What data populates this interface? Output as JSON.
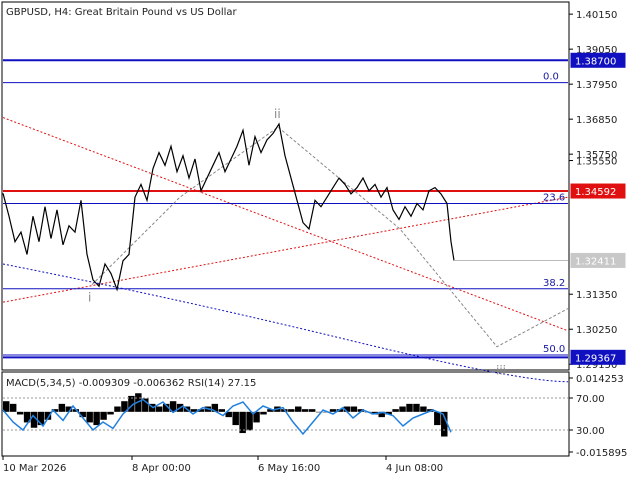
{
  "chart_data": [
    {
      "type": "line",
      "title": "GBPUSD, H4:  Great Britain Pound vs US Dollar",
      "ylim": [
        1.29,
        1.405
      ],
      "y_ticks": [
        "1.40150",
        "1.39050",
        "1.37950",
        "1.36850",
        "1.35750",
        "1.35550",
        "1.31350",
        "1.30250",
        "1.29150"
      ],
      "x_ticks": [
        "10 Mar 2026",
        "8 Apr 00:00",
        "6 May 16:00",
        "4 Jun 08:00"
      ],
      "price_series": [
        [
          0,
          1.3452
        ],
        [
          6,
          1.338
        ],
        [
          12,
          1.33
        ],
        [
          18,
          1.333
        ],
        [
          24,
          1.326
        ],
        [
          30,
          1.338
        ],
        [
          36,
          1.33
        ],
        [
          42,
          1.341
        ],
        [
          48,
          1.331
        ],
        [
          54,
          1.34
        ],
        [
          60,
          1.329
        ],
        [
          66,
          1.335
        ],
        [
          72,
          1.333
        ],
        [
          78,
          1.343
        ],
        [
          84,
          1.326
        ],
        [
          90,
          1.318
        ],
        [
          96,
          1.316
        ],
        [
          102,
          1.323
        ],
        [
          108,
          1.32
        ],
        [
          114,
          1.315
        ],
        [
          120,
          1.324
        ],
        [
          126,
          1.326
        ],
        [
          132,
          1.344
        ],
        [
          138,
          1.348
        ],
        [
          144,
          1.343
        ],
        [
          150,
          1.353
        ],
        [
          156,
          1.358
        ],
        [
          162,
          1.354
        ],
        [
          168,
          1.36
        ],
        [
          174,
          1.352
        ],
        [
          180,
          1.357
        ],
        [
          186,
          1.35
        ],
        [
          192,
          1.356
        ],
        [
          198,
          1.346
        ],
        [
          204,
          1.35
        ],
        [
          210,
          1.354
        ],
        [
          216,
          1.358
        ],
        [
          222,
          1.352
        ],
        [
          228,
          1.356
        ],
        [
          234,
          1.36
        ],
        [
          240,
          1.365
        ],
        [
          246,
          1.354
        ],
        [
          252,
          1.363
        ],
        [
          258,
          1.358
        ],
        [
          264,
          1.362
        ],
        [
          270,
          1.364
        ],
        [
          276,
          1.367
        ],
        [
          282,
          1.357
        ],
        [
          288,
          1.35
        ],
        [
          294,
          1.343
        ],
        [
          300,
          1.336
        ],
        [
          306,
          1.334
        ],
        [
          312,
          1.343
        ],
        [
          318,
          1.341
        ],
        [
          324,
          1.344
        ],
        [
          330,
          1.347
        ],
        [
          336,
          1.35
        ],
        [
          342,
          1.348
        ],
        [
          348,
          1.345
        ],
        [
          354,
          1.347
        ],
        [
          360,
          1.35
        ],
        [
          366,
          1.346
        ],
        [
          372,
          1.348
        ],
        [
          378,
          1.344
        ],
        [
          384,
          1.347
        ],
        [
          390,
          1.34
        ],
        [
          396,
          1.337
        ],
        [
          402,
          1.341
        ],
        [
          408,
          1.338
        ],
        [
          414,
          1.342
        ],
        [
          420,
          1.34
        ],
        [
          426,
          1.346
        ],
        [
          432,
          1.347
        ],
        [
          438,
          1.345
        ],
        [
          444,
          1.342
        ],
        [
          448,
          1.33
        ],
        [
          451,
          1.3241
        ]
      ],
      "red_lines": [
        {
          "price": "1.34592",
          "value": 1.34592,
          "color": "#e01010"
        }
      ],
      "blue_lines": [
        {
          "price": "1.38700",
          "value": 1.387,
          "color": "#1010c0"
        },
        {
          "price": "1.29367",
          "value": 1.29367,
          "color": "#1010c0"
        }
      ],
      "current_price": {
        "price": "1.32411",
        "value": 1.32411
      },
      "fibo_levels": [
        {
          "label": "0.0",
          "value": 1.38
        },
        {
          "label": "23.6",
          "value": 1.342
        },
        {
          "label": "38.2",
          "value": 1.3152
        },
        {
          "label": "50.0",
          "value": 1.2944
        }
      ],
      "wave_labels": [
        {
          "label": "i",
          "x": 92,
          "value": 1.315
        },
        {
          "label": "ii",
          "x": 278,
          "value": 1.368
        },
        {
          "label": "iii",
          "x": 500,
          "value": 1.292
        }
      ],
      "colors": {
        "price": "#000000",
        "red": "#e01010",
        "blue": "#1010c0",
        "fibo": "#1010c0",
        "grid": "#cccccc",
        "wave": "#888888",
        "red_dotted": "#e01010",
        "blue_dotted": "#1010c0"
      }
    },
    {
      "type": "bar",
      "title": "MACD(5,34,5) -0.009309 -0.006362 RSI(14) 27.15",
      "ylim": [
        -0.015895,
        0.014253
      ],
      "y_ticks": [
        "0.014253",
        "70.00",
        "30.00",
        "-0.015895"
      ],
      "macd_values": [
        0.004,
        0.003,
        -0.001,
        -0.004,
        -0.006,
        -0.005,
        -0.003,
        0.001,
        0.003,
        0.002,
        0.001,
        -0.002,
        -0.004,
        -0.005,
        -0.003,
        -0.001,
        0.002,
        0.004,
        0.006,
        0.007,
        0.005,
        0.003,
        0.002,
        0.003,
        0.004,
        0.003,
        0.002,
        0.001,
        0.001,
        0.002,
        0.003,
        0.001,
        -0.002,
        -0.005,
        -0.008,
        -0.007,
        -0.004,
        -0.001,
        0.001,
        0.002,
        0.001,
        0.001,
        0.002,
        0.001,
        0.001,
        0.0,
        0.0,
        0.001,
        0.001,
        0.002,
        0.002,
        0.001,
        0.0,
        -0.001,
        -0.002,
        -0.001,
        0.001,
        0.002,
        0.003,
        0.003,
        0.002,
        0.001,
        -0.005,
        -0.009309
      ],
      "rsi_series": [
        [
          0,
          55
        ],
        [
          10,
          40
        ],
        [
          20,
          30
        ],
        [
          30,
          48
        ],
        [
          40,
          35
        ],
        [
          50,
          55
        ],
        [
          60,
          42
        ],
        [
          70,
          60
        ],
        [
          80,
          45
        ],
        [
          90,
          30
        ],
        [
          100,
          40
        ],
        [
          110,
          32
        ],
        [
          120,
          50
        ],
        [
          130,
          62
        ],
        [
          140,
          68
        ],
        [
          150,
          58
        ],
        [
          160,
          65
        ],
        [
          170,
          52
        ],
        [
          180,
          60
        ],
        [
          190,
          50
        ],
        [
          200,
          58
        ],
        [
          210,
          55
        ],
        [
          220,
          48
        ],
        [
          230,
          60
        ],
        [
          240,
          65
        ],
        [
          250,
          50
        ],
        [
          260,
          60
        ],
        [
          270,
          55
        ],
        [
          280,
          58
        ],
        [
          290,
          40
        ],
        [
          300,
          25
        ],
        [
          310,
          40
        ],
        [
          320,
          55
        ],
        [
          330,
          50
        ],
        [
          340,
          58
        ],
        [
          350,
          45
        ],
        [
          360,
          55
        ],
        [
          370,
          50
        ],
        [
          380,
          52
        ],
        [
          390,
          48
        ],
        [
          400,
          35
        ],
        [
          410,
          45
        ],
        [
          420,
          50
        ],
        [
          430,
          55
        ],
        [
          440,
          50
        ],
        [
          448,
          27.15
        ]
      ]
    }
  ]
}
